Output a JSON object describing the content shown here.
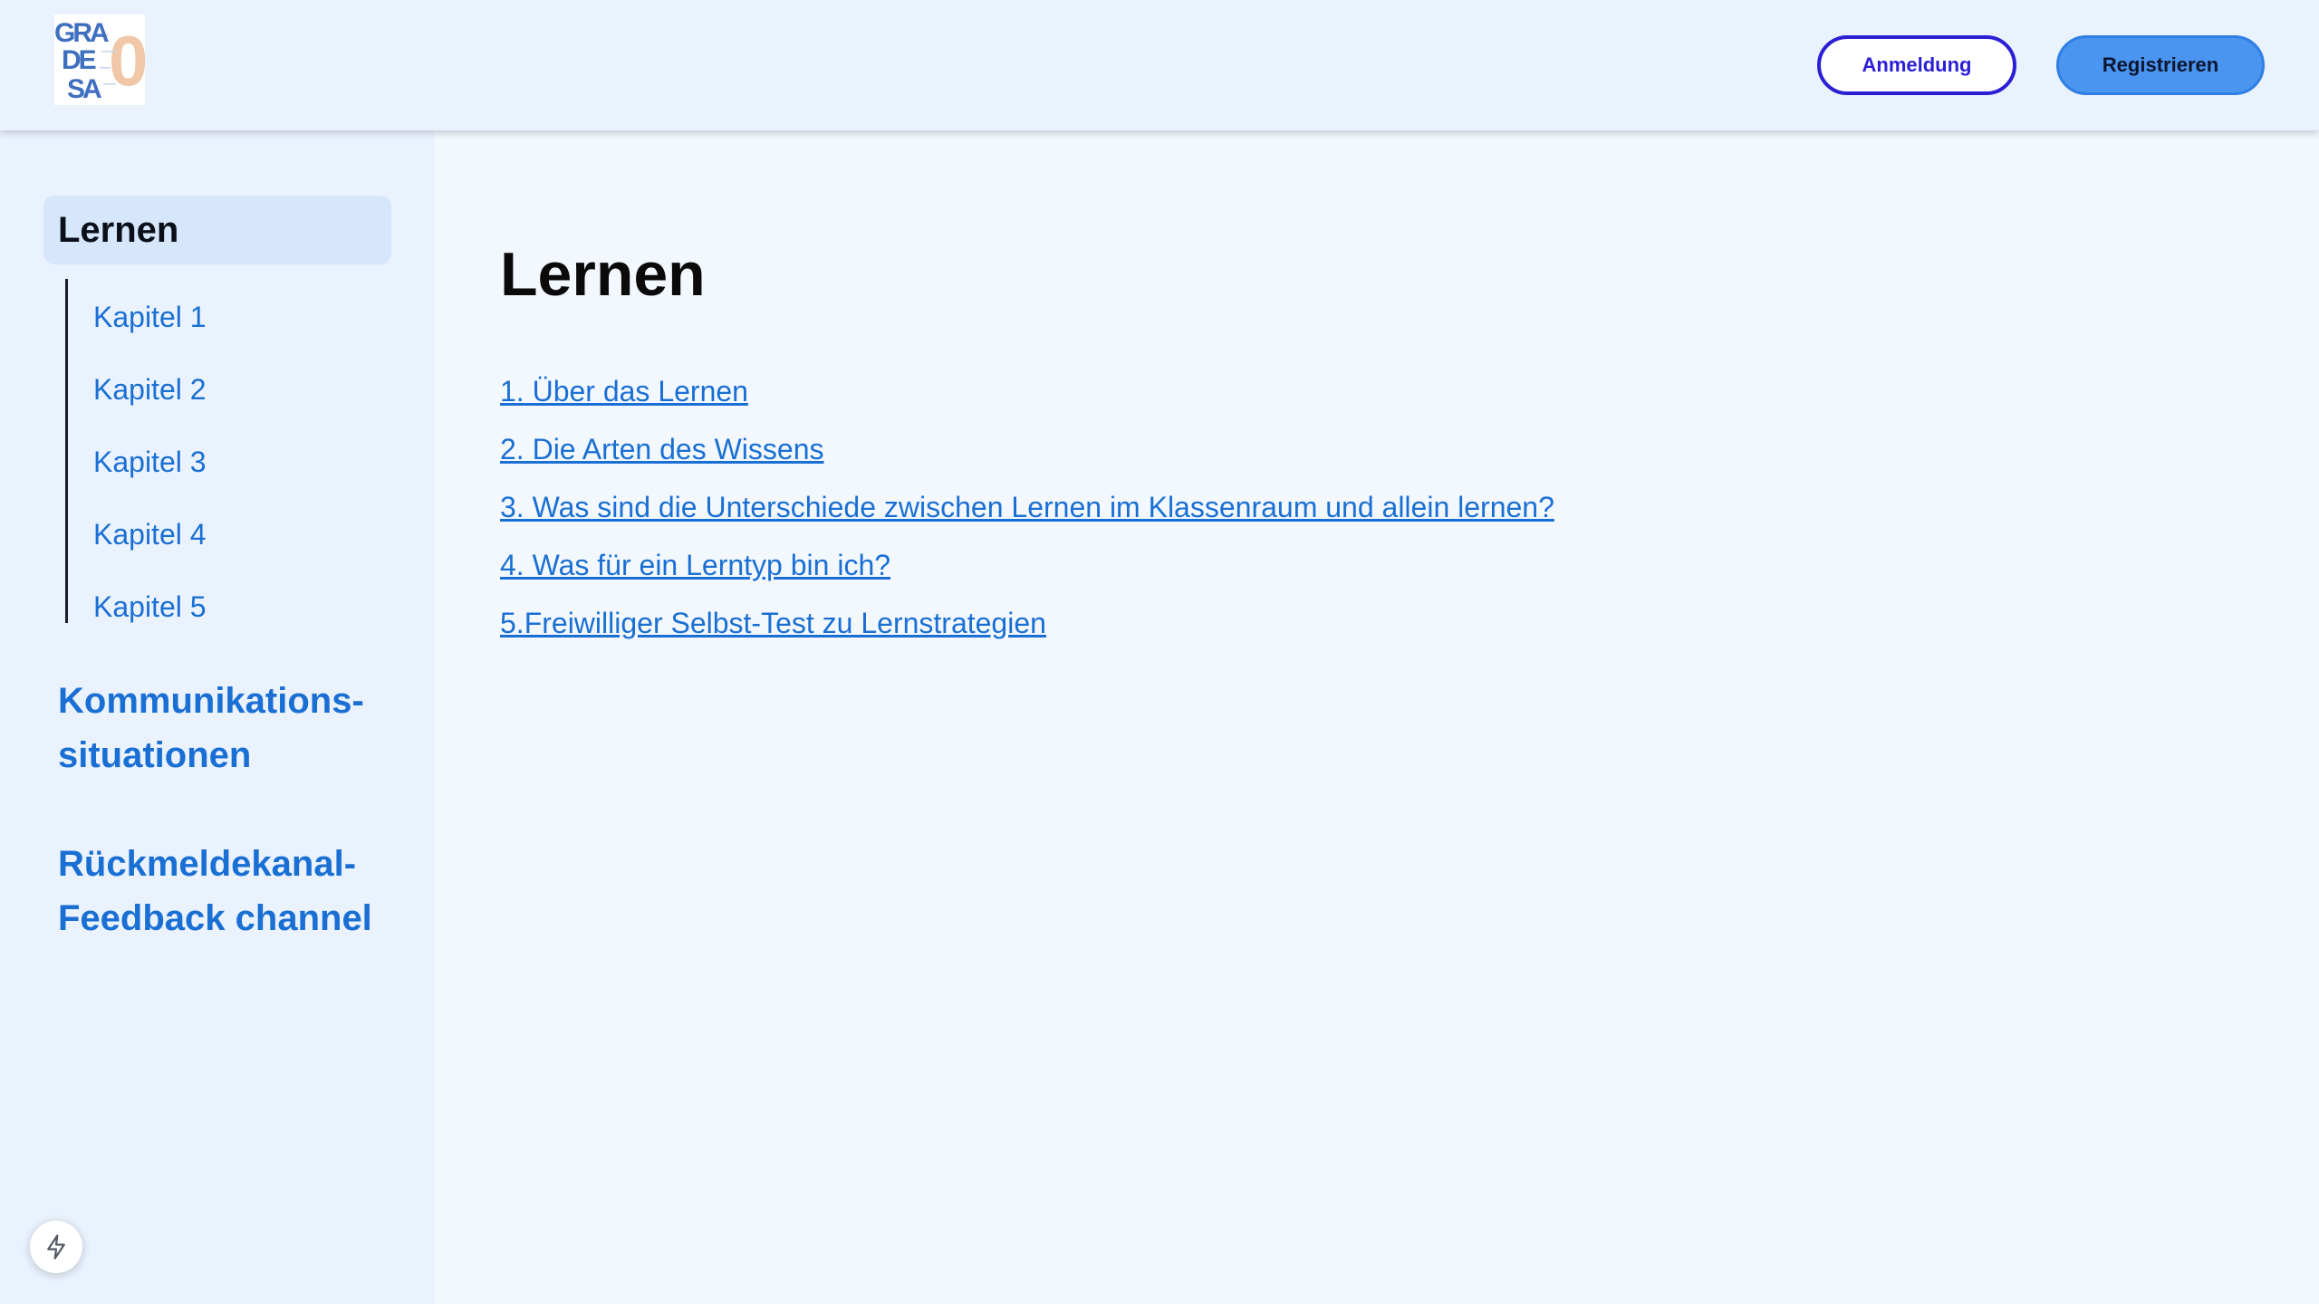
{
  "header": {
    "logo_lines": [
      "GRA",
      "DE",
      "SA",
      "0"
    ],
    "login_label": "Anmeldung",
    "register_label": "Registrieren"
  },
  "sidebar": {
    "active_section": "Lernen",
    "chapters": [
      "Kapitel 1",
      "Kapitel 2",
      "Kapitel 3",
      "Kapitel 4",
      "Kapitel 5"
    ],
    "sections": [
      {
        "line1": "Kommunikations-",
        "line2": "situationen"
      },
      {
        "line1": "Rückmeldekanal-",
        "line2": "Feedback channel"
      }
    ]
  },
  "main": {
    "title": "Lernen",
    "links": [
      "1. Über das Lernen",
      "2. Die Arten des Wissens",
      "3. Was sind die Unterschiede zwischen Lernen im Klassenraum und allein lernen?",
      "4. Was für ein Lerntyp bin ich?",
      "5.Freiwilliger Selbst-Test zu Lernstrategien"
    ]
  },
  "fab": {
    "icon": "lightning-icon"
  },
  "colors": {
    "accent": "#1a6fd4",
    "login_border": "#2b1fd6",
    "register_bg": "#4a95f0",
    "sidebar_bg": "#eaf2fd",
    "main_bg": "#f3f8fe"
  }
}
